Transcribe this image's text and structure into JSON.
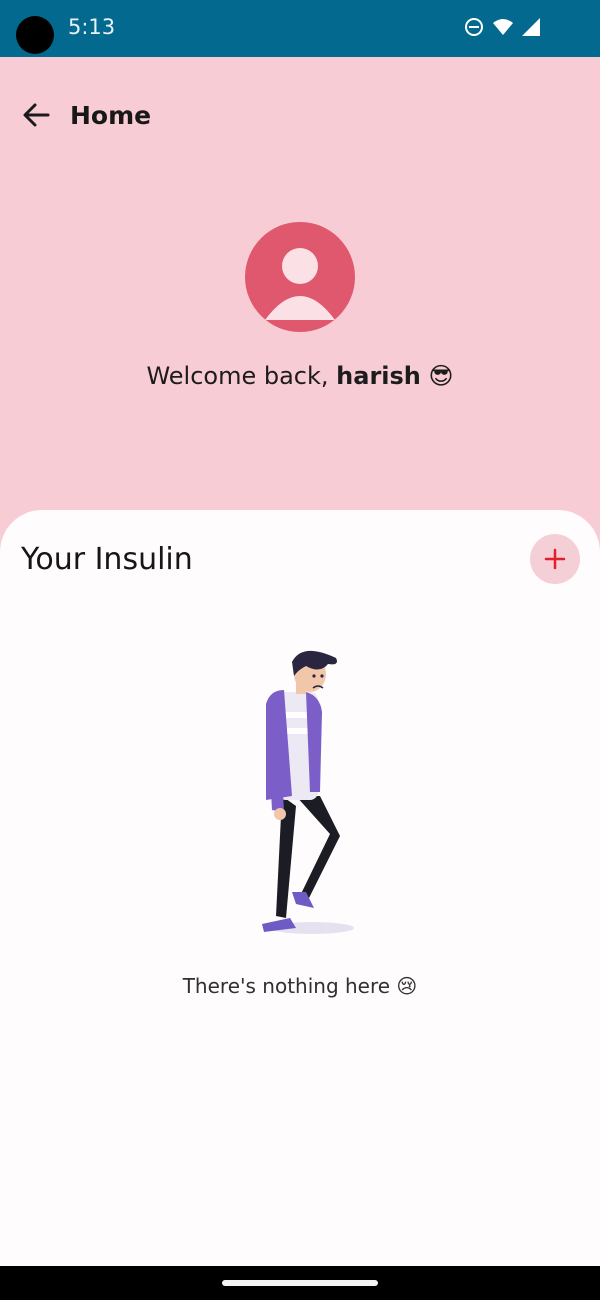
{
  "status_bar": {
    "time": "5:13",
    "icons": [
      "dnd-icon",
      "wifi-icon",
      "signal-icon"
    ],
    "background": "#03698e"
  },
  "header": {
    "back_icon": "arrow-left-icon",
    "title": "Home"
  },
  "profile": {
    "avatar_icon": "user-avatar-icon",
    "avatar_color": "#e0586d",
    "welcome_prefix": "Welcome back, ",
    "user_name": "harish",
    "welcome_emoji": "😎"
  },
  "insulin_card": {
    "title": "Your Insulin",
    "add_icon": "plus-icon",
    "add_color": "#e21f2b",
    "illustration": "sad-person-illustration",
    "empty_text": "There's nothing here",
    "empty_emoji": "😢"
  },
  "colors": {
    "page_background": "#f8ccd5",
    "card_background": "#fefcfd"
  }
}
